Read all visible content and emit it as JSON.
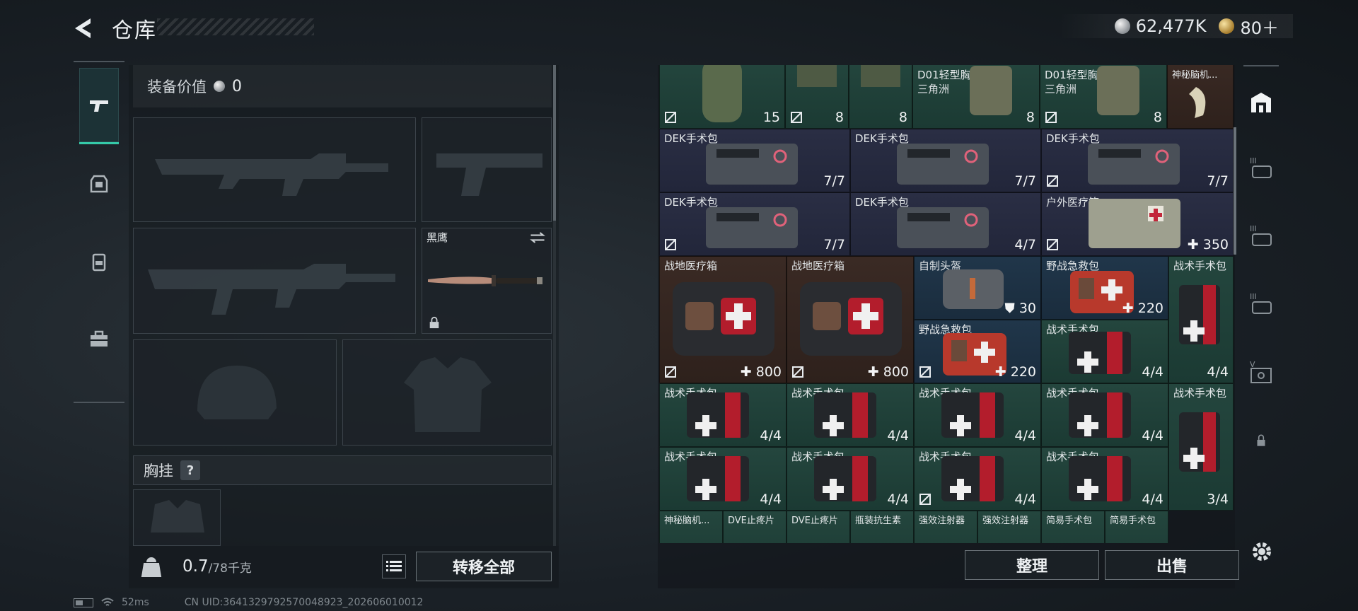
{
  "title": "仓库",
  "currency": {
    "coins": "62,477K",
    "tokens": "80＋"
  },
  "loadout": {
    "equip_value_label": "装备价值",
    "equip_value": "0",
    "melee_name": "黑鹰",
    "chest_rig_label": "胸挂",
    "chest_help": "?",
    "weight_value": "0.7",
    "weight_max": "/78千克",
    "transfer_all": "转移全部"
  },
  "grid": {
    "row0": [
      {
        "name": "",
        "sub": "",
        "qty": "15"
      },
      {
        "name": "",
        "sub": "",
        "qty": "8"
      },
      {
        "name": "",
        "sub": "",
        "qty": "8"
      },
      {
        "name": "D01轻型胸挂",
        "sub": "三角洲",
        "qty": "8"
      },
      {
        "name": "D01轻型胸挂",
        "sub": "三角洲",
        "qty": "8"
      },
      {
        "name": "神秘脑机...",
        "sub": "",
        "qty": ""
      }
    ],
    "row1": [
      {
        "name": "DEK手术包",
        "qty": "7/7"
      },
      {
        "name": "DEK手术包",
        "qty": "7/7"
      },
      {
        "name": "DEK手术包",
        "qty": "7/7"
      }
    ],
    "row2": [
      {
        "name": "DEK手术包",
        "qty": "7/7"
      },
      {
        "name": "DEK手术包",
        "qty": "4/7"
      },
      {
        "name": "户外医疗箱",
        "qty": "350"
      }
    ],
    "row3": [
      {
        "name": "战地医疗箱",
        "qty": "800"
      },
      {
        "name": "战地医疗箱",
        "qty": "800"
      },
      {
        "name": "自制头盔",
        "qty": "30"
      },
      {
        "name": "野战急救包",
        "qty": "220"
      },
      {
        "name": "战术手术包",
        "qty": "4/4"
      }
    ],
    "row4": [
      {
        "name": "野战急救包",
        "qty": "220"
      },
      {
        "name": "战术手术包",
        "qty": "4/4"
      }
    ],
    "row5": [
      {
        "name": "战术手术包",
        "qty": "4/4"
      },
      {
        "name": "战术手术包",
        "qty": "4/4"
      },
      {
        "name": "战术手术包",
        "qty": "4/4"
      },
      {
        "name": "战术手术包",
        "qty": "4/4"
      },
      {
        "name": "战术手术包",
        "qty": "3/4"
      }
    ],
    "row6": [
      {
        "name": "战术手术包",
        "qty": "4/4"
      },
      {
        "name": "战术手术包",
        "qty": "4/4"
      },
      {
        "name": "战术手术包",
        "qty": "4/4"
      },
      {
        "name": "战术手术包",
        "qty": "4/4"
      }
    ],
    "row7": [
      {
        "name": "神秘脑机..."
      },
      {
        "name": "DVE止疼片"
      },
      {
        "name": "DVE止疼片"
      },
      {
        "name": "瓶装抗生素"
      },
      {
        "name": "强效注射器"
      },
      {
        "name": "强效注射器"
      },
      {
        "name": "简易手术包"
      },
      {
        "name": "简易手术包"
      }
    ]
  },
  "actions": {
    "sort": "整理",
    "sell": "出售"
  },
  "status": {
    "ping": "52ms",
    "uid": "CN UID:3641329792570048923_202606010012"
  }
}
